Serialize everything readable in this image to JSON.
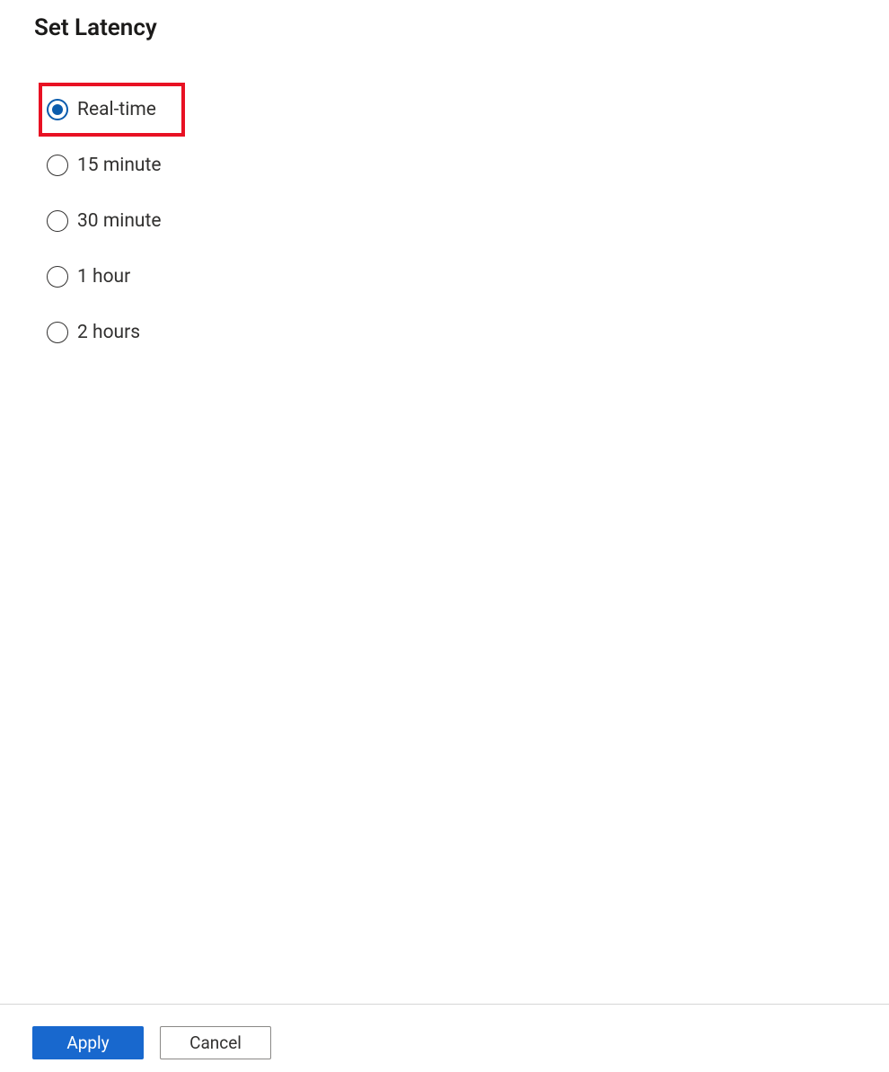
{
  "title": "Set Latency",
  "options": [
    {
      "label": "Real-time",
      "selected": true,
      "highlighted": true
    },
    {
      "label": "15 minute",
      "selected": false,
      "highlighted": false
    },
    {
      "label": "30 minute",
      "selected": false,
      "highlighted": false
    },
    {
      "label": "1 hour",
      "selected": false,
      "highlighted": false
    },
    {
      "label": "2 hours",
      "selected": false,
      "highlighted": false
    }
  ],
  "footer": {
    "apply_label": "Apply",
    "cancel_label": "Cancel"
  },
  "colors": {
    "highlight_border": "#e81123",
    "radio_selected": "#0b5cad",
    "primary_button": "#1868ce"
  }
}
